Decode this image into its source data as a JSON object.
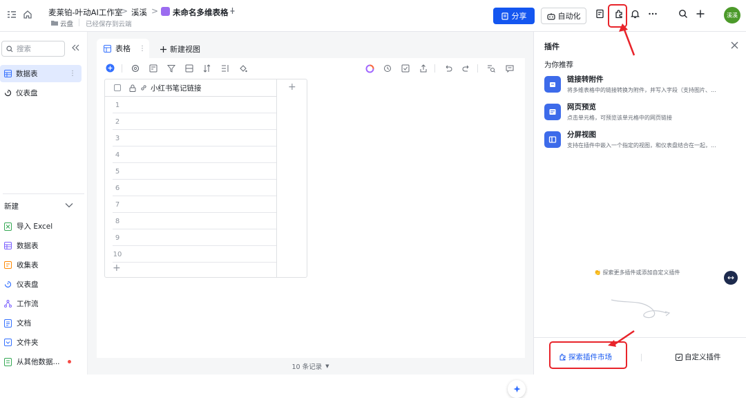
{
  "topbar": {
    "breadcrumb": [
      "麦莱铂-叶动AI工作室",
      "溪溪",
      "未命名多维表格"
    ],
    "separator": ">",
    "location_label": "云盘",
    "save_status": "已经保存到云端",
    "share_label": "分享",
    "automation_label": "自动化",
    "avatar_text": "溪溪",
    "accent": "#1456f0"
  },
  "sidebar": {
    "search_placeholder": "搜索",
    "items": [
      {
        "label": "数据表",
        "icon": "table-icon"
      },
      {
        "label": "仪表盘",
        "icon": "dashboard-icon"
      }
    ],
    "new_section_title": "新建",
    "new_items": [
      {
        "label": "导入 Excel",
        "icon": "excel-icon"
      },
      {
        "label": "数据表",
        "icon": "table-icon"
      },
      {
        "label": "收集表",
        "icon": "form-icon"
      },
      {
        "label": "仪表盘",
        "icon": "dashboard-icon"
      },
      {
        "label": "工作流",
        "icon": "workflow-icon"
      },
      {
        "label": "文档",
        "icon": "doc-icon"
      },
      {
        "label": "文件夹",
        "icon": "folder-icon"
      },
      {
        "label": "从其他数据...",
        "icon": "sync-icon"
      }
    ]
  },
  "main": {
    "tabs": [
      {
        "label": "表格"
      }
    ],
    "new_view_label": "新建视图",
    "column_header": "小红书笔记链接",
    "rows": [
      "1",
      "2",
      "3",
      "4",
      "5",
      "6",
      "7",
      "8",
      "9",
      "10"
    ],
    "record_count": "10 条记录"
  },
  "plugins": {
    "title": "插件",
    "recommend_title": "为你推荐",
    "items": [
      {
        "name": "链接转附件",
        "desc": "将多维表格中的链接转换为附件，并写入字段（支持图片、..."
      },
      {
        "name": "网页预览",
        "desc": "点击单元格，可预览该单元格中的网页链接"
      },
      {
        "name": "分屏视图",
        "desc": "支持在插件中嵌入一个指定的视图，和仪表盘结合在一起，..."
      }
    ],
    "explore_hint": "探索更多插件或添加自定义插件",
    "market_label": "探索插件市场",
    "custom_label": "自定义插件"
  }
}
